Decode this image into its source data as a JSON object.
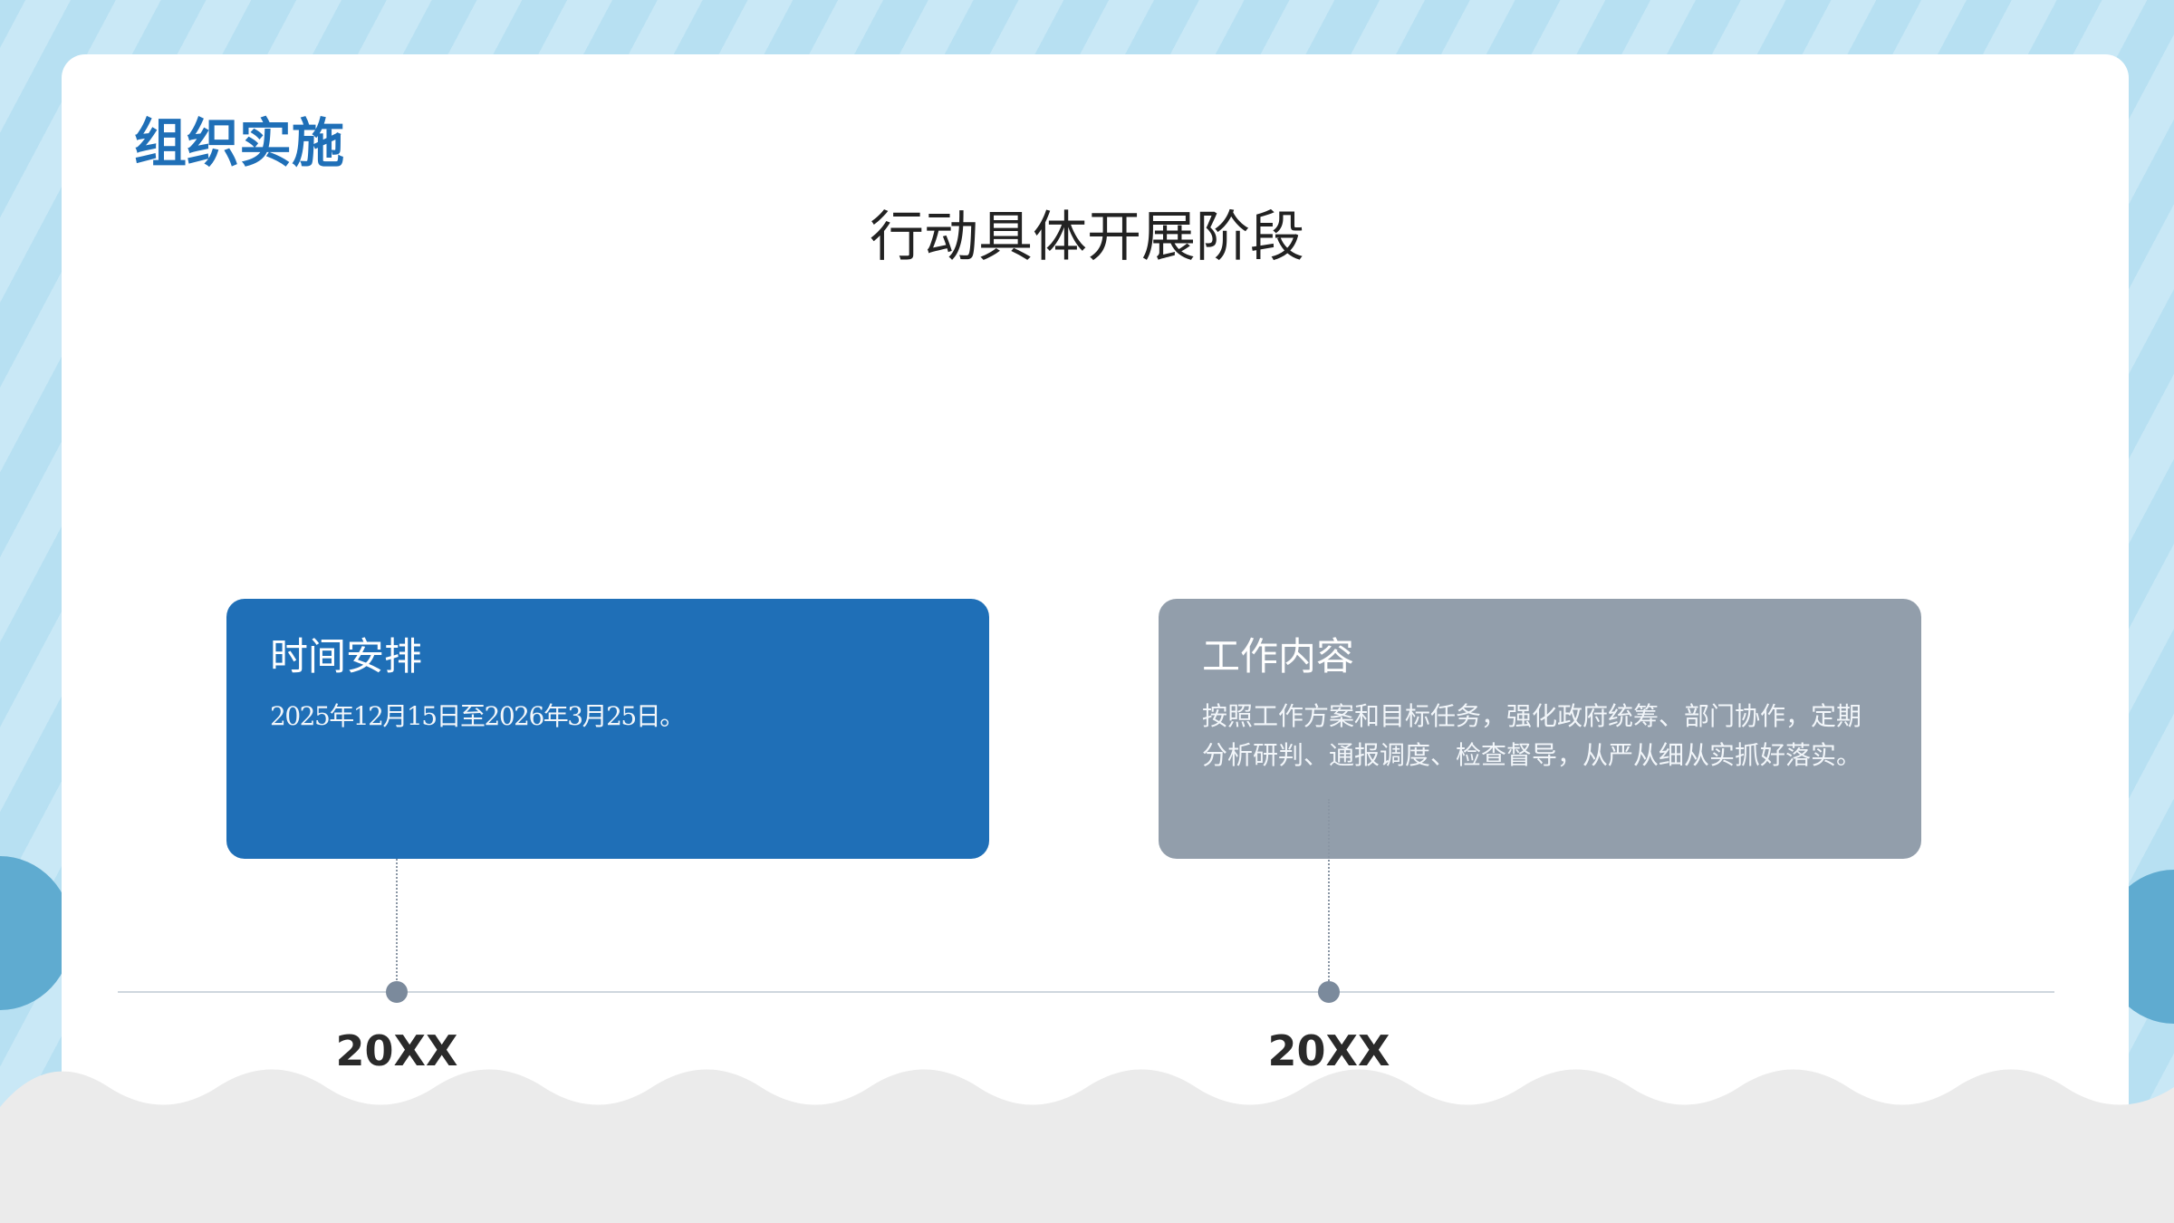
{
  "slide": {
    "title": "组织实施",
    "subtitle": "行动具体开展阶段"
  },
  "stages": [
    {
      "heading": "时间安排",
      "body": "2025年12月15日至2026年3月25日。",
      "color": "#1f6fb7"
    },
    {
      "heading": "工作内容",
      "body": "按照工作方案和目标任务，强化政府统筹、部门协作，定期分析研判、通报调度、检查督导，从严从细从实抓好落实。",
      "color": "#929eab"
    }
  ],
  "timeline": {
    "labels": [
      "20XX",
      "20XX"
    ]
  },
  "colors": {
    "accent": "#1f6fb7",
    "background_stripe": "#b7e0f2",
    "wave": "#ebebeb"
  }
}
